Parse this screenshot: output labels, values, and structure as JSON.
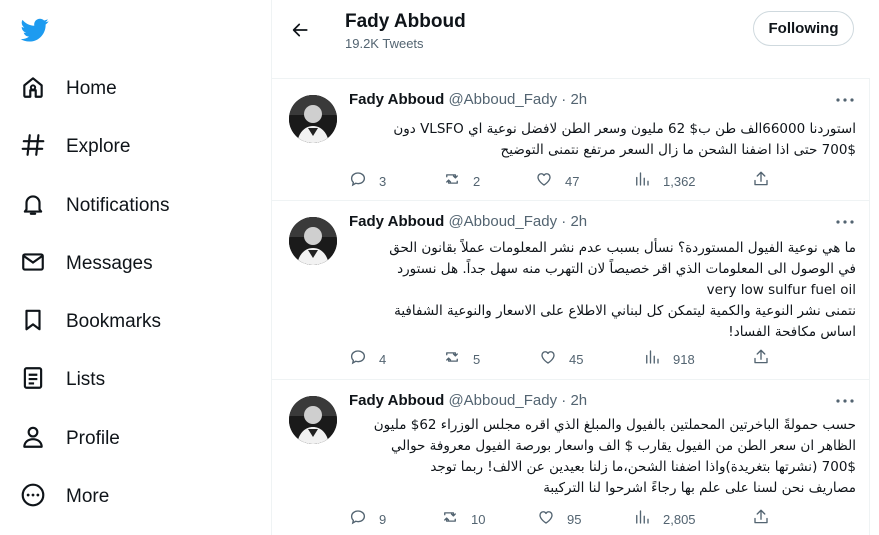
{
  "colors": {
    "brand": "#1d9bf0",
    "text": "#0f1419",
    "muted": "#536471",
    "border": "#eff3f4"
  },
  "sidebar": {
    "logo_icon": "twitter-bird-icon",
    "items": [
      {
        "label": "Home",
        "icon": "home-icon"
      },
      {
        "label": "Explore",
        "icon": "hashtag-icon"
      },
      {
        "label": "Notifications",
        "icon": "bell-icon"
      },
      {
        "label": "Messages",
        "icon": "envelope-icon"
      },
      {
        "label": "Bookmarks",
        "icon": "bookmark-icon"
      },
      {
        "label": "Lists",
        "icon": "list-icon"
      },
      {
        "label": "Profile",
        "icon": "person-icon"
      },
      {
        "label": "More",
        "icon": "more-circle-icon"
      }
    ]
  },
  "header": {
    "name": "Fady Abboud",
    "tweet_count": "19.2K Tweets",
    "follow_label": "Following"
  },
  "tweets": [
    {
      "name": "Fady Abboud",
      "handle": "@Abboud_Fady",
      "dot": "·",
      "time": "2h",
      "lines": [
        "استوردنا 66000الف طن ب$ 62 مليون وسعر الطن لافضل نوعية اي VLSFO دون",
        "700$ حتى اذا اضفنا الشحن ما زال السعر مرتفع نتمنى التوضيح"
      ],
      "replies": "3",
      "retweets": "2",
      "likes": "47",
      "views": "1,362"
    },
    {
      "name": "Fady Abboud",
      "handle": "@Abboud_Fady",
      "dot": "·",
      "time": "2h",
      "lines": [
        "ما هي نوعية الفيول المستوردة؟ نسأل بسبب عدم نشر المعلومات عملاً بقانون الحق",
        "في الوصول الى المعلومات الذي اقر خصيصاً لان التهرب منه سهل جداً. هل نستورد",
        "very low sulfur fuel oil",
        "نتمنى نشر النوعية والكمية ليتمكن كل لبناني الاطلاع على الاسعار والنوعية الشفافية",
        "اساس مكافحة الفساد!"
      ],
      "replies": "4",
      "retweets": "5",
      "likes": "45",
      "views": "918"
    },
    {
      "name": "Fady Abboud",
      "handle": "@Abboud_Fady",
      "dot": "·",
      "time": "2h",
      "lines": [
        "حسب حمولةً الباخرتين المحملتين بالفيول والمبلغ الذي اقره مجلس الوزراء 62$ مليون",
        "الظاهر ان سعر الطن من الفيول يقارب $ الف واسعار بورصة الفيول معروفة حوالي",
        "700$ (نشرتها بتغريدة)واذا اضفنا الشحن،ما زلنا بعيدين عن الالف! ربما توجد",
        "مصاريف نحن لسنا على علم بها رجاءً اشرحوا لنا التركيبة"
      ],
      "replies": "9",
      "retweets": "10",
      "likes": "95",
      "views": "2,805"
    }
  ]
}
